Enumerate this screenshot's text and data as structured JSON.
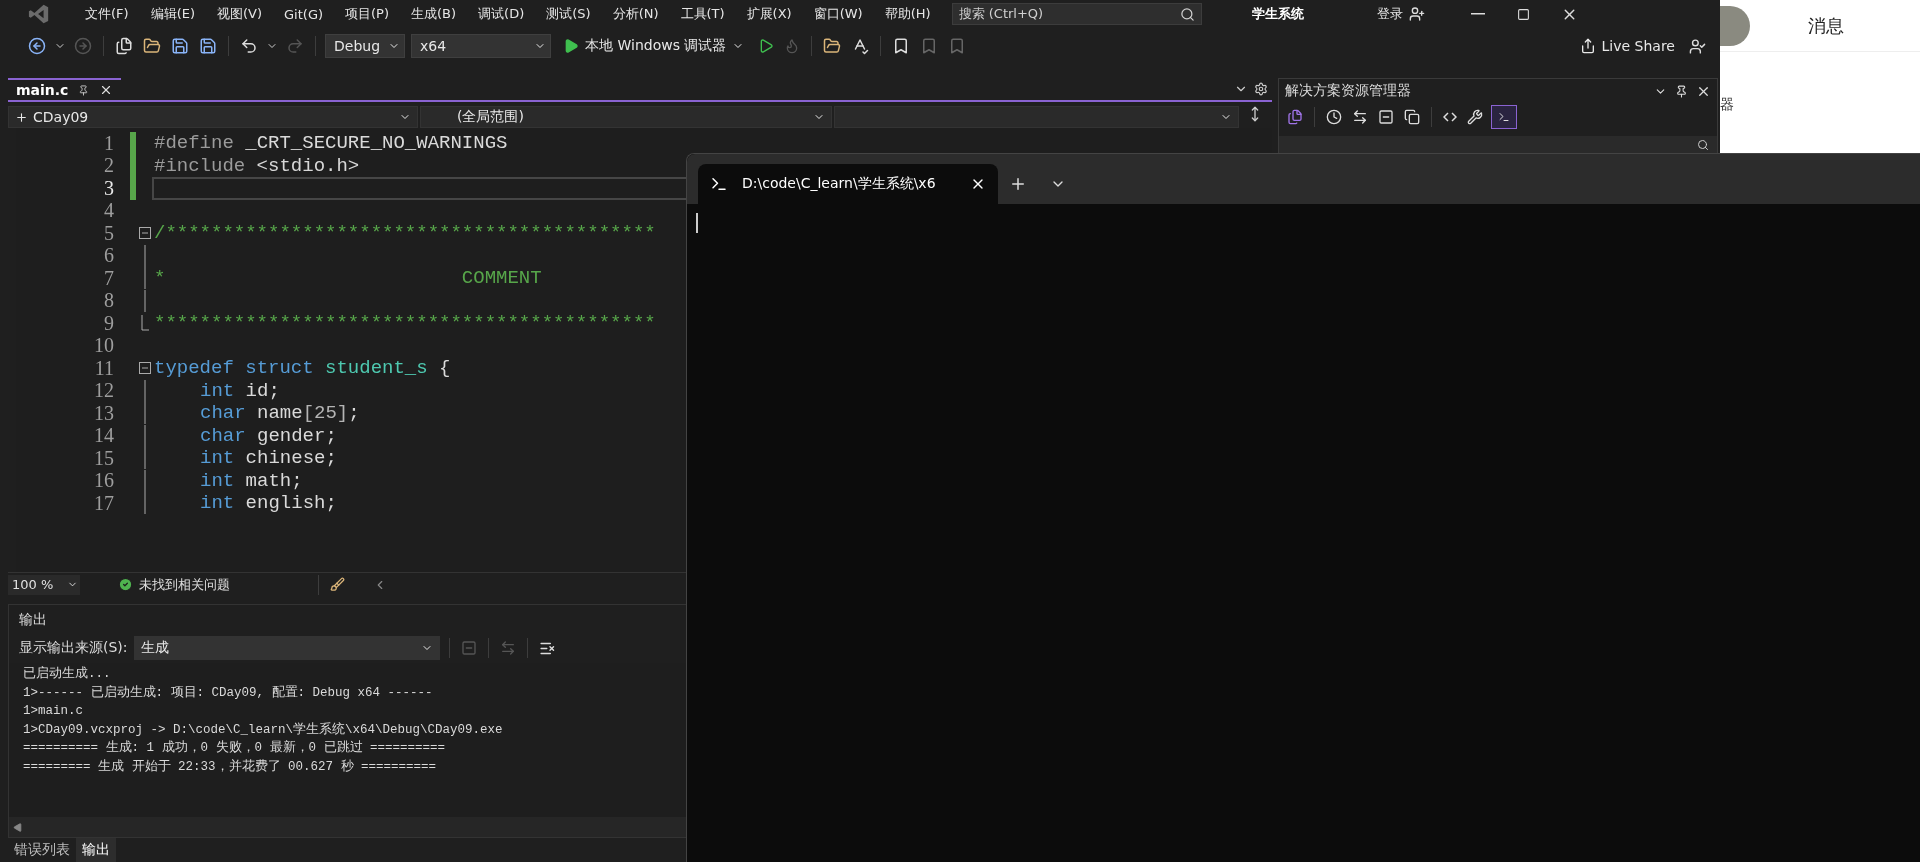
{
  "menu_bar": {
    "items": [
      "文件(F)",
      "编辑(E)",
      "视图(V)",
      "Git(G)",
      "项目(P)",
      "生成(B)",
      "调试(D)",
      "测试(S)",
      "分析(N)",
      "工具(T)",
      "扩展(X)",
      "窗口(W)",
      "帮助(H)"
    ],
    "search": {
      "placeholder": "搜索 (Ctrl+Q)"
    },
    "solution_name": "学生系统",
    "sign_in": "登录"
  },
  "toolbar": {
    "configuration": "Debug",
    "platform": "x64",
    "run_target": "本地 Windows 调试器",
    "live_share": "Live Share"
  },
  "editor": {
    "tabs": [
      {
        "label": "main.c",
        "selected": true
      }
    ],
    "project": "CDay09",
    "scope": "(全局范围)",
    "lines": [
      {
        "n": "1",
        "changed": true,
        "current": false,
        "kind": "plain",
        "tokens": [
          {
            "kind": "pp",
            "text": "#define"
          },
          {
            "kind": "plain",
            "text": " _CRT_SECURE_NO_WARNINGS"
          }
        ]
      },
      {
        "n": "2",
        "changed": true,
        "current": false,
        "kind": "plain",
        "tokens": [
          {
            "kind": "pp",
            "text": "#include"
          },
          {
            "kind": "str",
            "text": " <stdio.h>"
          }
        ]
      },
      {
        "n": "3",
        "changed": true,
        "current": true,
        "kind": "plain"
      },
      {
        "n": "4",
        "changed": false,
        "current": false,
        "kind": "plain"
      },
      {
        "n": "5",
        "changed": false,
        "current": false,
        "kind": "fold-start",
        "tokens": [
          {
            "kind": "cm",
            "text": "/*******************************************"
          }
        ]
      },
      {
        "n": "6",
        "changed": false,
        "current": false,
        "kind": "fold-inner"
      },
      {
        "n": "7",
        "changed": false,
        "current": false,
        "kind": "fold-inner",
        "tokens": [
          {
            "kind": "cm",
            "text": "*                          COMMENT"
          }
        ]
      },
      {
        "n": "8",
        "changed": false,
        "current": false,
        "kind": "fold-inner"
      },
      {
        "n": "9",
        "changed": false,
        "current": false,
        "kind": "fold-end",
        "tokens": [
          {
            "kind": "cm",
            "text": "********************************************"
          }
        ]
      },
      {
        "n": "10",
        "changed": false,
        "current": false,
        "kind": "plain"
      },
      {
        "n": "11",
        "changed": false,
        "current": false,
        "kind": "fold-start",
        "tokens": [
          {
            "kind": "kw",
            "text": "typedef"
          },
          {
            "kind": "kw",
            "text": " struct"
          },
          {
            "kind": "type",
            "text": " student_s"
          },
          {
            "kind": "plain",
            "text": " {"
          }
        ]
      },
      {
        "n": "12",
        "changed": false,
        "current": false,
        "kind": "fold-inner",
        "indent": true,
        "tokens": [
          {
            "kind": "kw",
            "text": "int"
          },
          {
            "kind": "plain",
            "text": " id;"
          }
        ]
      },
      {
        "n": "13",
        "changed": false,
        "current": false,
        "kind": "fold-inner",
        "indent": true,
        "tokens": [
          {
            "kind": "kw",
            "text": "char"
          },
          {
            "kind": "plain",
            "text": " name"
          },
          {
            "kind": "num",
            "text": "[25]"
          },
          {
            "kind": "plain",
            "text": ";"
          }
        ]
      },
      {
        "n": "14",
        "changed": false,
        "current": false,
        "kind": "fold-inner",
        "indent": true,
        "tokens": [
          {
            "kind": "kw",
            "text": "char"
          },
          {
            "kind": "plain",
            "text": " gender;"
          }
        ]
      },
      {
        "n": "15",
        "changed": false,
        "current": false,
        "kind": "fold-inner",
        "indent": true,
        "tokens": [
          {
            "kind": "kw",
            "text": "int"
          },
          {
            "kind": "plain",
            "text": " chinese;"
          }
        ]
      },
      {
        "n": "16",
        "changed": false,
        "current": false,
        "kind": "fold-inner",
        "indent": true,
        "tokens": [
          {
            "kind": "kw",
            "text": "int"
          },
          {
            "kind": "plain",
            "text": " math;"
          }
        ]
      },
      {
        "n": "17",
        "changed": false,
        "current": false,
        "kind": "fold-inner",
        "indent": true,
        "tokens": [
          {
            "kind": "kw",
            "text": "int"
          },
          {
            "kind": "plain",
            "text": " english;"
          }
        ]
      }
    ],
    "zoom": "100 %",
    "issues": "未找到相关问题"
  },
  "output": {
    "title": "输出",
    "source_label": "显示输出来源(S):",
    "source": "生成",
    "lines": [
      "已启动生成...",
      "1>------ 已启动生成: 项目: CDay09, 配置: Debug x64 ------",
      "1>main.c",
      "1>CDay09.vcxproj -> D:\\code\\C_learn\\学生系统\\x64\\Debug\\CDay09.exe",
      "========== 生成: 1 成功，0 失败，0 最新，0 已跳过 ==========",
      "========= 生成 开始于 22:33，并花费了 00.627 秒 =========="
    ]
  },
  "bottom_tabs": [
    {
      "label": "错误列表",
      "selected": false
    },
    {
      "label": "输出",
      "selected": true
    }
  ],
  "solution_explorer": {
    "title": "解决方案资源管理器"
  },
  "terminal": {
    "tabs": [
      {
        "title": "D:\\code\\C_learn\\学生系统\\x6",
        "selected": true
      }
    ]
  },
  "browser": {
    "messages": "消息",
    "side_text": "器"
  }
}
